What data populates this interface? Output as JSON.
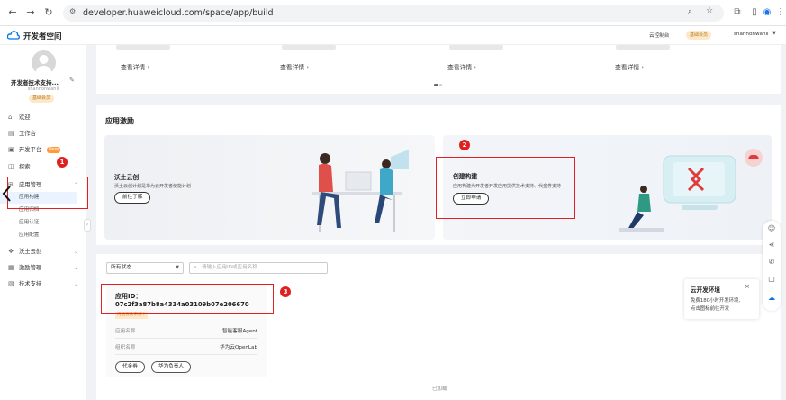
{
  "browser": {
    "url": "developer.huaweicloud.com/space/app/build"
  },
  "header": {
    "app_title": "开发者空间",
    "link": "云控制台",
    "member_badge": "基础会员",
    "username": "shannonwanli",
    "colors": {
      "accent": "#e02020",
      "brand": "#0073e6"
    }
  },
  "sidebar": {
    "user_name": "开发者技术支持...",
    "user_id": "shannonwanli",
    "member_badge": "基础会员",
    "items": [
      {
        "icon": "home-icon",
        "label": "欢迎"
      },
      {
        "icon": "desk-icon",
        "label": "工作台"
      },
      {
        "icon": "platform-icon",
        "label": "开发平台",
        "badge": "New"
      },
      {
        "icon": "explore-icon",
        "label": "探索"
      },
      {
        "icon": "app-manage-icon",
        "label": "应用管理"
      },
      {
        "icon": "wotu-icon",
        "label": "沃土云创"
      },
      {
        "icon": "incentive-icon",
        "label": "激励管理"
      },
      {
        "icon": "support-icon",
        "label": "技术支持"
      }
    ],
    "subitems": [
      "应用构建",
      "应用归档",
      "应用认证",
      "应用配置"
    ]
  },
  "top_cards": {
    "detail_label": "查看详情",
    "count": 4
  },
  "incentive": {
    "title": "应用激励",
    "banner1": {
      "title": "沃土云创",
      "desc": "沃土云创计划是华为云开发者使能计划",
      "button": "前往了解"
    },
    "banner2": {
      "title": "创建构建",
      "desc": "应用构建为开发者开发应用提供技术支持、代金券支持",
      "button": "立即申请"
    }
  },
  "app_list": {
    "status_select": "所有状态",
    "search_placeholder": "请输入应用ID或应用名称",
    "card": {
      "id_label": "应用ID：",
      "id_value": "07c2f3a87b8a4334a03109b07e206670",
      "status_tag": "沟通资质审核中",
      "rows": [
        {
          "label": "应用名称",
          "value": "智能客服Agent"
        },
        {
          "label": "组织名称",
          "value": "华为云OpenLab"
        }
      ],
      "buttons": [
        "代金券",
        "华为负责人"
      ]
    },
    "footer": "已加载"
  },
  "popup": {
    "title": "云开发环境",
    "desc_line1": "免费180小时开发环境,",
    "desc_line2": "点击图标前往开发"
  },
  "annotations": [
    "1",
    "2",
    "3"
  ]
}
